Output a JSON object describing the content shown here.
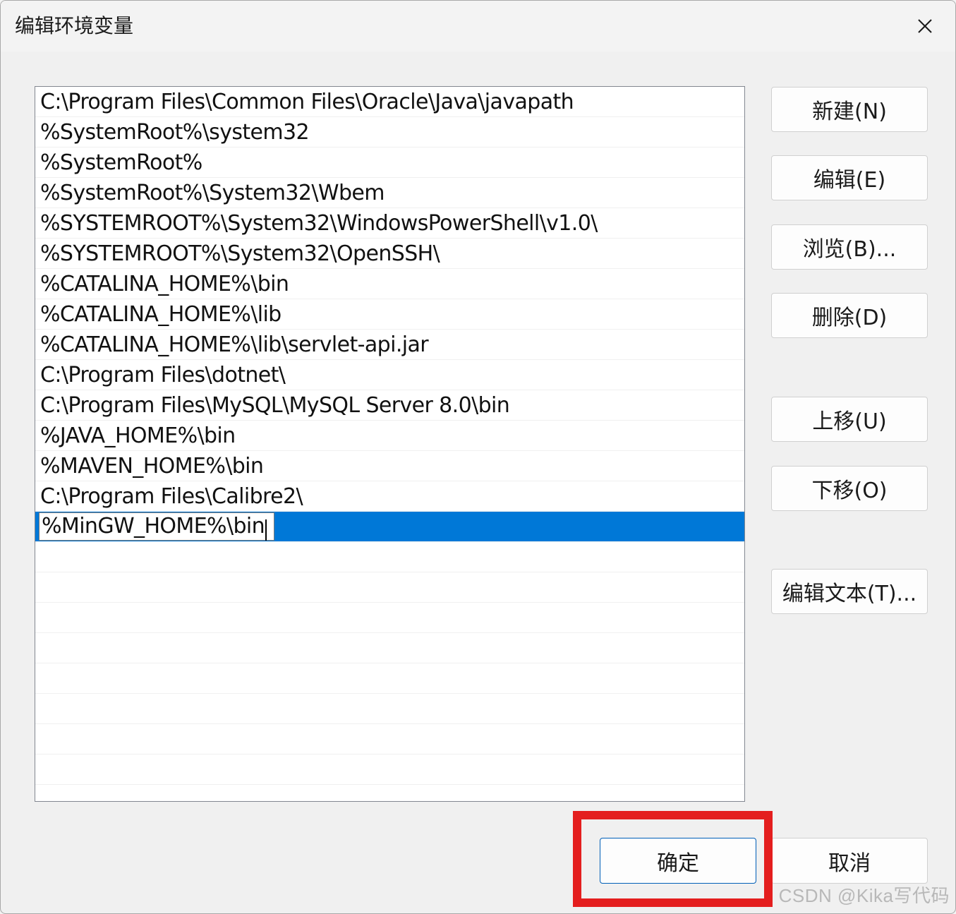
{
  "window": {
    "title": "编辑环境变量",
    "close_label": "关闭"
  },
  "path_list": {
    "items": [
      "C:\\Program Files\\Common Files\\Oracle\\Java\\javapath",
      "%SystemRoot%\\system32",
      "%SystemRoot%",
      "%SystemRoot%\\System32\\Wbem",
      "%SYSTEMROOT%\\System32\\WindowsPowerShell\\v1.0\\",
      "%SYSTEMROOT%\\System32\\OpenSSH\\",
      "%CATALINA_HOME%\\bin",
      "%CATALINA_HOME%\\lib",
      "%CATALINA_HOME%\\lib\\servlet-api.jar",
      "C:\\Program Files\\dotnet\\",
      "C:\\Program Files\\MySQL\\MySQL Server 8.0\\bin",
      "%JAVA_HOME%\\bin",
      "%MAVEN_HOME%\\bin",
      "C:\\Program Files\\Calibre2\\"
    ],
    "editing_value": "%MinGW_HOME%\\bin"
  },
  "side_buttons": {
    "new": "新建(N)",
    "edit": "编辑(E)",
    "browse": "浏览(B)...",
    "delete": "删除(D)",
    "move_up": "上移(U)",
    "move_down": "下移(O)",
    "edit_text": "编辑文本(T)..."
  },
  "footer": {
    "ok": "确定",
    "cancel": "取消"
  },
  "watermark": "CSDN @Kika写代码",
  "colors": {
    "selection": "#0078d7",
    "highlight_border": "#e41e1e",
    "ok_border": "#005fb8"
  }
}
